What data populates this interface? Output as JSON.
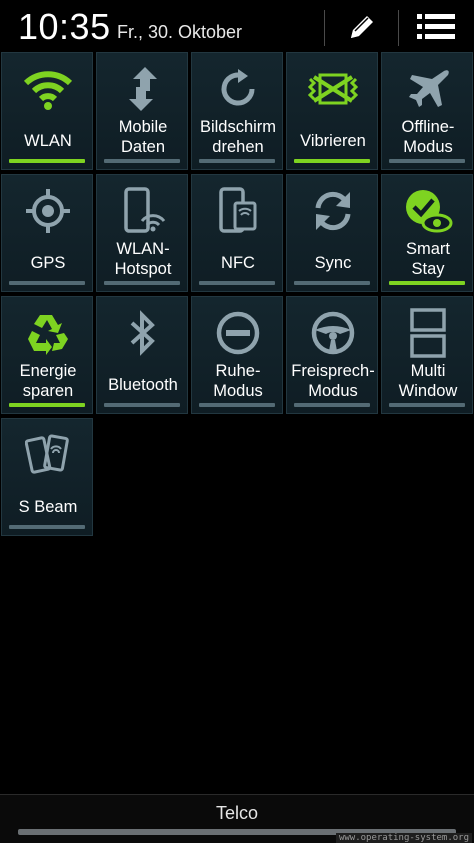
{
  "status": {
    "time": "10:35",
    "date": "Fr., 30. Oktober"
  },
  "toggles": [
    {
      "label": "WLAN",
      "on": true
    },
    {
      "label": "Mobile\nDaten",
      "on": false
    },
    {
      "label": "Bildschirm\ndrehen",
      "on": false
    },
    {
      "label": "Vibrieren",
      "on": true
    },
    {
      "label": "Offline-\nModus",
      "on": false
    },
    {
      "label": "GPS",
      "on": false
    },
    {
      "label": "WLAN-\nHotspot",
      "on": false
    },
    {
      "label": "NFC",
      "on": false
    },
    {
      "label": "Sync",
      "on": false
    },
    {
      "label": "Smart\nStay",
      "on": true
    },
    {
      "label": "Energie\nsparen",
      "on": true
    },
    {
      "label": "Bluetooth",
      "on": false
    },
    {
      "label": "Ruhe-\nModus",
      "on": false
    },
    {
      "label": "Freisprech-\nModus",
      "on": false
    },
    {
      "label": "Multi\nWindow",
      "on": false
    },
    {
      "label": "S Beam",
      "on": false
    }
  ],
  "colors": {
    "accent": "#7ed321",
    "icon": "#8fa3ad",
    "tile": "#13242c"
  },
  "footer": {
    "carrier": "Telco",
    "watermark": "www.operating-system.org"
  }
}
